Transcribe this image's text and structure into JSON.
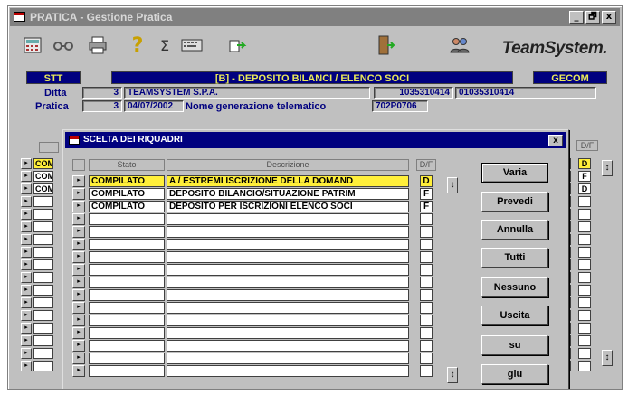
{
  "window": {
    "title": "PRATICA - Gestione Pratica",
    "minimize": "_",
    "maximize": "🗗",
    "close": "x"
  },
  "toolbar": {
    "icons": [
      "calculator-icon",
      "glasses-icon",
      "printer-icon",
      "help-icon",
      "sigma-icon",
      "keyboard-icon",
      "export-icon",
      "exit-door-icon",
      "people-icon"
    ],
    "brand": "TeamSystem."
  },
  "header": {
    "module_code": "STT",
    "section_title": "[B] - DEPOSITO BILANCI / ELENCO SOCI",
    "app_code": "GECOM",
    "ditta_label": "Ditta",
    "ditta_number": "3",
    "ditta_name": "TEAMSYSTEM S.P.A.",
    "partita_iva": "1035310414",
    "codice_fiscale": "01035310414",
    "pratica_label": "Pratica",
    "pratica_number": "3",
    "pratica_date": "04/07/2002",
    "nome_gen_label": "Nome generazione telematico",
    "nome_gen_value": "702P0706"
  },
  "background": {
    "right_col_header": "D/F",
    "left_cells": [
      "COM",
      "COM",
      "COM"
    ],
    "right_cells": [
      "D",
      "F",
      "D"
    ]
  },
  "dialog": {
    "title": "SCELTA DEI RIQUADRI",
    "close": "x",
    "columns": {
      "stato": "Stato",
      "descrizione": "Descrizione",
      "df": "D/F"
    },
    "rows": [
      {
        "stato": "COMPILATO",
        "descrizione": "A / ESTREMI ISCRIZIONE DELLA DOMAND",
        "df": "D",
        "selected": true
      },
      {
        "stato": "COMPILATO",
        "descrizione": "DEPOSITO BILANCIO/SITUAZIONE PATRIM",
        "df": "F",
        "selected": false
      },
      {
        "stato": "COMPILATO",
        "descrizione": "DEPOSITO PER ISCRIZIONI ELENCO SOCI",
        "df": "F",
        "selected": false
      }
    ],
    "buttons": {
      "varia": "Varia",
      "prevedi": "Prevedi",
      "annulla": "Annulla",
      "tutti": "Tutti",
      "nessuno": "Nessuno",
      "uscita": "Uscita",
      "su": "su",
      "giu": "giu"
    }
  }
}
